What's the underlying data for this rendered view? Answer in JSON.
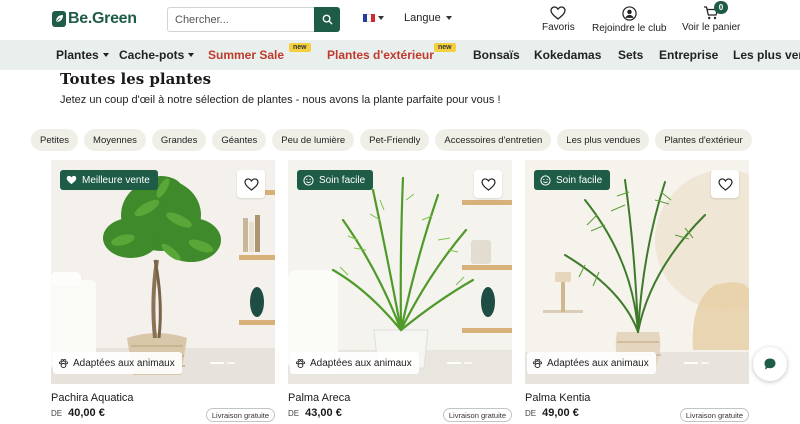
{
  "header": {
    "logo_text": "Be.Green",
    "search_placeholder": "Chercher...",
    "language_label": "Langue",
    "flag_colors": [
      "#1f3f99",
      "#ffffff",
      "#d62828"
    ],
    "actions": [
      {
        "label": "Favoris",
        "icon": "heart-outline-icon"
      },
      {
        "label": "Rejoindre le club",
        "icon": "user-circle-icon"
      },
      {
        "label": "Voir le panier",
        "icon": "cart-icon",
        "count": "0"
      }
    ]
  },
  "nav": {
    "items": [
      {
        "label": "Plantes",
        "dropdown": true,
        "highlight": false,
        "new_badge": ""
      },
      {
        "label": "Cache-pots",
        "dropdown": true,
        "highlight": false,
        "new_badge": ""
      },
      {
        "label": "Summer Sale",
        "dropdown": false,
        "highlight": true,
        "new_badge": "new"
      },
      {
        "label": "Plantes d'extérieur",
        "dropdown": false,
        "highlight": true,
        "new_badge": "new"
      },
      {
        "label": "Bonsaïs",
        "dropdown": false,
        "highlight": false,
        "new_badge": ""
      },
      {
        "label": "Kokedamas",
        "dropdown": false,
        "highlight": false,
        "new_badge": ""
      },
      {
        "label": "Sets",
        "dropdown": false,
        "highlight": false,
        "new_badge": ""
      },
      {
        "label": "Entreprise",
        "dropdown": false,
        "highlight": false,
        "new_badge": ""
      },
      {
        "label": "Les plus ven",
        "dropdown": false,
        "highlight": false,
        "new_badge": ""
      }
    ]
  },
  "page": {
    "title": "Toutes les plantes",
    "subtitle": "Jetez un coup d'œil à notre sélection de plantes - nous avons la plante parfaite pour vous !"
  },
  "filters": [
    "Petites",
    "Moyennes",
    "Grandes",
    "Géantes",
    "Peu de lumière",
    "Pet-Friendly",
    "Accessoires d'entretien",
    "Les plus vendues",
    "Plantes d'extérieur"
  ],
  "products": [
    {
      "name": "Pachira Aquatica",
      "price_prefix": "DE",
      "price": "40,00 €",
      "top_badge": "Meilleure vente",
      "top_badge_icon": "heart-filled-icon",
      "pet_badge": "Adaptées aux animaux",
      "shipping": "Livraison gratuite"
    },
    {
      "name": "Palma Areca",
      "price_prefix": "DE",
      "price": "43,00 €",
      "top_badge": "Soin facile",
      "top_badge_icon": "smiley-icon",
      "pet_badge": "Adaptées aux animaux",
      "shipping": "Livraison gratuite"
    },
    {
      "name": "Palma Kentia",
      "price_prefix": "DE",
      "price": "49,00 €",
      "top_badge": "Soin facile",
      "top_badge_icon": "smiley-icon",
      "pet_badge": "Adaptées aux animaux",
      "shipping": "Livraison gratuite"
    }
  ],
  "colors": {
    "brand": "#1f5c48",
    "nav_bg": "#e8efed",
    "sale_red": "#c0392b",
    "new_badge": "#f4d03f",
    "chip_bg": "#efefe7"
  }
}
